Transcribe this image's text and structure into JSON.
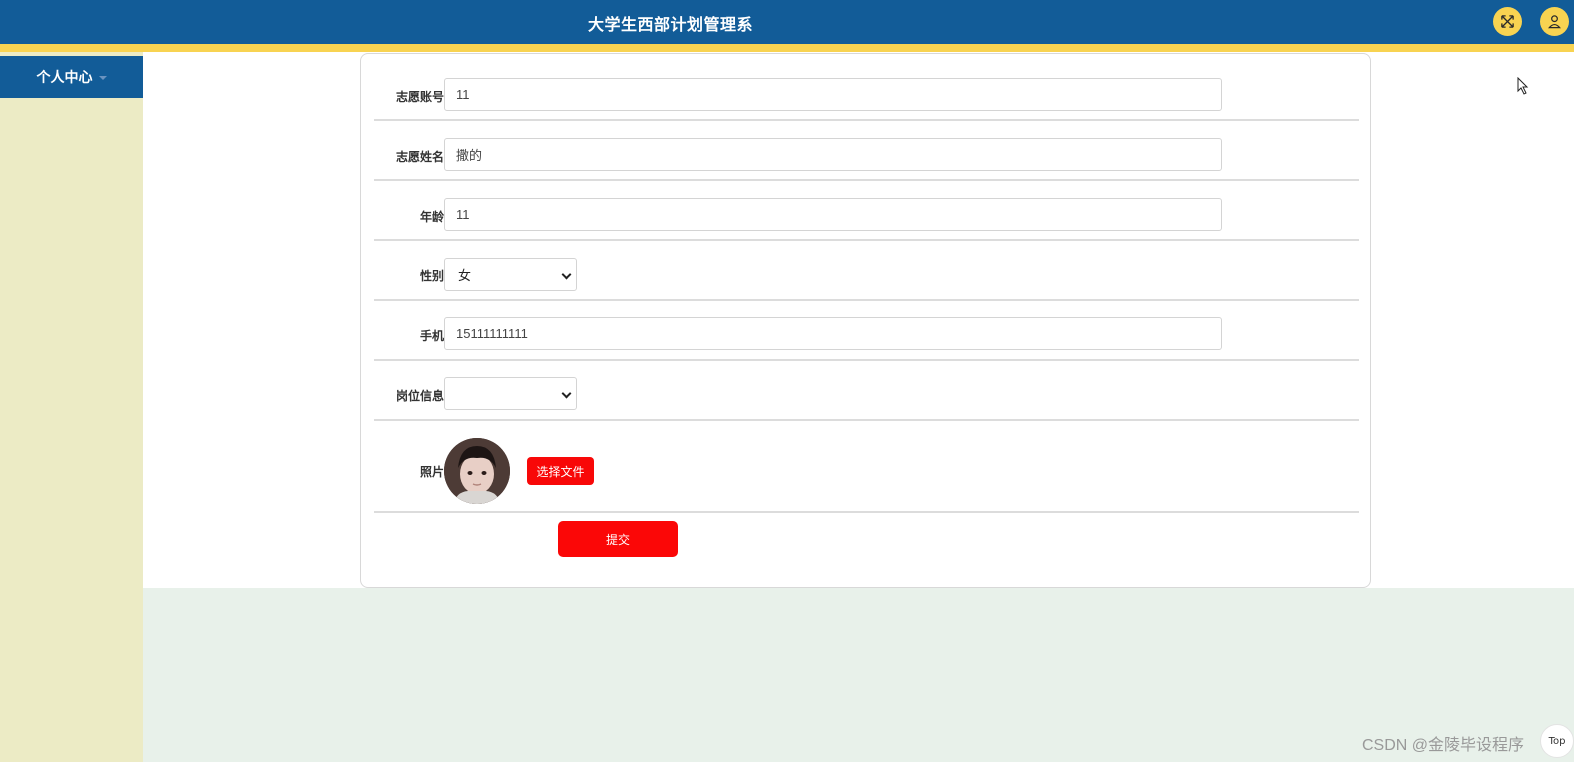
{
  "header": {
    "title": "大学生西部计划管理系",
    "fullscreen_icon": "expand-arrows-icon",
    "user_icon": "user-icon"
  },
  "sidebar": {
    "items": [
      {
        "label": "个人中心"
      }
    ]
  },
  "form": {
    "account": {
      "label": "志愿账号",
      "value": "11"
    },
    "name": {
      "label": "志愿姓名",
      "value": "撒的"
    },
    "age": {
      "label": "年龄",
      "value": "11"
    },
    "gender": {
      "label": "性别",
      "value": "女"
    },
    "phone": {
      "label": "手机",
      "value": "15111111111"
    },
    "position": {
      "label": "岗位信息",
      "value": ""
    },
    "photo": {
      "label": "照片",
      "button_label": "选择文件"
    },
    "submit_label": "提交"
  },
  "footer": {
    "watermark": "CSDN @金陵毕设程序",
    "top_label": "Top"
  },
  "colors": {
    "header_bg": "#125c98",
    "accent_yellow": "#f8d351",
    "sidebar_bg": "#ecebc5",
    "button_red": "#fb0707",
    "content_bottom_bg": "#e8f1ea"
  }
}
